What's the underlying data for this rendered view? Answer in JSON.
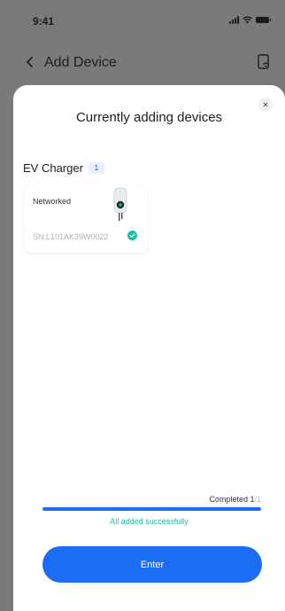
{
  "status_bar": {
    "time": "9:41"
  },
  "nav": {
    "title": "Add Device"
  },
  "sheet": {
    "title": "Currently adding devices",
    "section": {
      "label": "EV Charger",
      "count": "1"
    },
    "devices": [
      {
        "state": "Networked",
        "serial": "SN:L101AK39W0022",
        "status_icon": "check-circle-icon"
      }
    ],
    "progress": {
      "label_prefix": "Completed ",
      "done": "1",
      "total": "/1",
      "fraction": 1.0,
      "status": "All added successfully"
    },
    "enter_label": "Enter"
  },
  "colors": {
    "accent": "#1b6ef3",
    "success": "#14c1a6",
    "overlay": "#7a7a7a"
  }
}
